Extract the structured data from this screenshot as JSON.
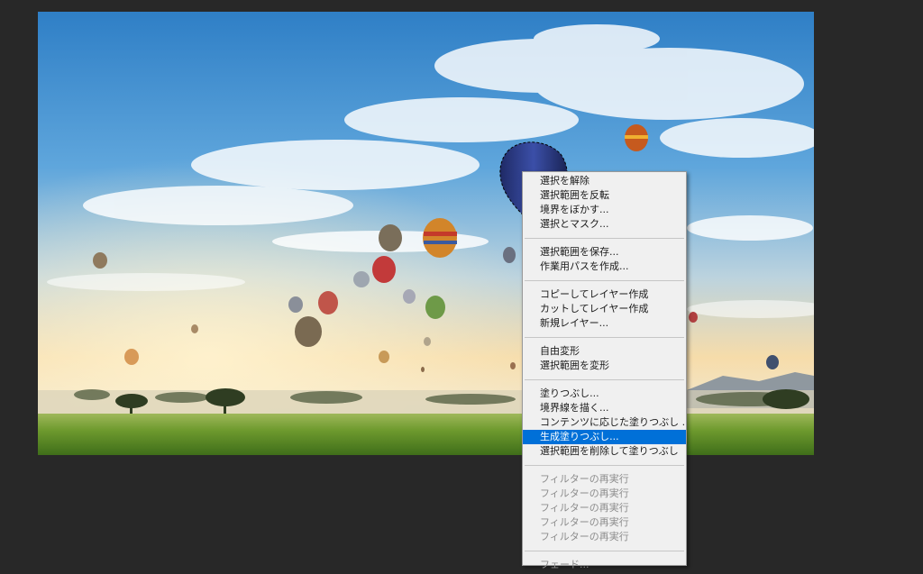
{
  "canvas": {
    "image_description_icon": "hot-air-balloon-photo",
    "selection": "marching-ants-around-balloon"
  },
  "context_menu": {
    "groups": [
      {
        "items": [
          {
            "label": "選択を解除",
            "enabled": true
          },
          {
            "label": "選択範囲を反転",
            "enabled": true
          },
          {
            "label": "境界をぼかす...",
            "enabled": true
          },
          {
            "label": "選択とマスク...",
            "enabled": true
          }
        ]
      },
      {
        "items": [
          {
            "label": "選択範囲を保存...",
            "enabled": true
          },
          {
            "label": "作業用パスを作成...",
            "enabled": true
          }
        ]
      },
      {
        "items": [
          {
            "label": "コピーしてレイヤー作成",
            "enabled": true
          },
          {
            "label": "カットしてレイヤー作成",
            "enabled": true
          },
          {
            "label": "新規レイヤー...",
            "enabled": true
          }
        ]
      },
      {
        "items": [
          {
            "label": "自由変形",
            "enabled": true
          },
          {
            "label": "選択範囲を変形",
            "enabled": true
          }
        ]
      },
      {
        "items": [
          {
            "label": "塗りつぶし...",
            "enabled": true
          },
          {
            "label": "境界線を描く...",
            "enabled": true
          },
          {
            "label": "コンテンツに応じた塗りつぶし ...",
            "enabled": true
          },
          {
            "label": "生成塗りつぶし...",
            "enabled": true,
            "highlighted": true
          },
          {
            "label": "選択範囲を削除して塗りつぶし",
            "enabled": true
          }
        ]
      },
      {
        "items": [
          {
            "label": "フィルターの再実行",
            "enabled": false
          },
          {
            "label": "フィルターの再実行",
            "enabled": false
          },
          {
            "label": "フィルターの再実行",
            "enabled": false
          },
          {
            "label": "フィルターの再実行",
            "enabled": false
          },
          {
            "label": "フィルターの再実行",
            "enabled": false
          }
        ]
      },
      {
        "items": [
          {
            "label": "フェード...",
            "enabled": false
          }
        ]
      }
    ],
    "highlight_color": "#0070d8"
  }
}
